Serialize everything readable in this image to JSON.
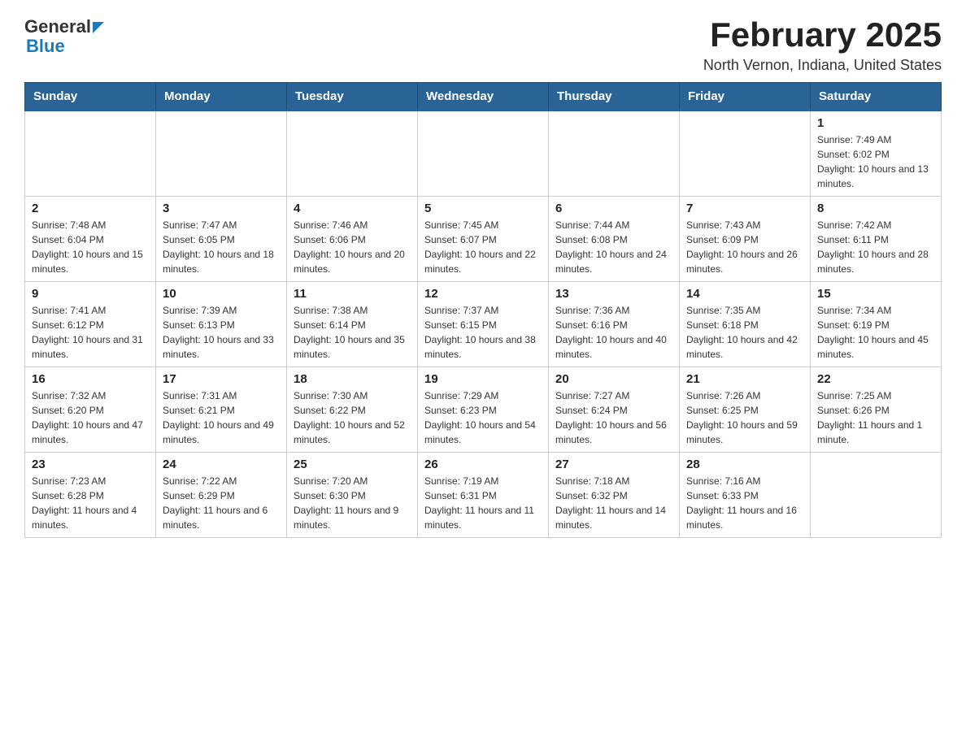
{
  "header": {
    "logo_general": "General",
    "logo_blue": "Blue",
    "title": "February 2025",
    "subtitle": "North Vernon, Indiana, United States"
  },
  "weekdays": [
    "Sunday",
    "Monday",
    "Tuesday",
    "Wednesday",
    "Thursday",
    "Friday",
    "Saturday"
  ],
  "weeks": [
    [
      {
        "day": "",
        "info": ""
      },
      {
        "day": "",
        "info": ""
      },
      {
        "day": "",
        "info": ""
      },
      {
        "day": "",
        "info": ""
      },
      {
        "day": "",
        "info": ""
      },
      {
        "day": "",
        "info": ""
      },
      {
        "day": "1",
        "info": "Sunrise: 7:49 AM\nSunset: 6:02 PM\nDaylight: 10 hours and 13 minutes."
      }
    ],
    [
      {
        "day": "2",
        "info": "Sunrise: 7:48 AM\nSunset: 6:04 PM\nDaylight: 10 hours and 15 minutes."
      },
      {
        "day": "3",
        "info": "Sunrise: 7:47 AM\nSunset: 6:05 PM\nDaylight: 10 hours and 18 minutes."
      },
      {
        "day": "4",
        "info": "Sunrise: 7:46 AM\nSunset: 6:06 PM\nDaylight: 10 hours and 20 minutes."
      },
      {
        "day": "5",
        "info": "Sunrise: 7:45 AM\nSunset: 6:07 PM\nDaylight: 10 hours and 22 minutes."
      },
      {
        "day": "6",
        "info": "Sunrise: 7:44 AM\nSunset: 6:08 PM\nDaylight: 10 hours and 24 minutes."
      },
      {
        "day": "7",
        "info": "Sunrise: 7:43 AM\nSunset: 6:09 PM\nDaylight: 10 hours and 26 minutes."
      },
      {
        "day": "8",
        "info": "Sunrise: 7:42 AM\nSunset: 6:11 PM\nDaylight: 10 hours and 28 minutes."
      }
    ],
    [
      {
        "day": "9",
        "info": "Sunrise: 7:41 AM\nSunset: 6:12 PM\nDaylight: 10 hours and 31 minutes."
      },
      {
        "day": "10",
        "info": "Sunrise: 7:39 AM\nSunset: 6:13 PM\nDaylight: 10 hours and 33 minutes."
      },
      {
        "day": "11",
        "info": "Sunrise: 7:38 AM\nSunset: 6:14 PM\nDaylight: 10 hours and 35 minutes."
      },
      {
        "day": "12",
        "info": "Sunrise: 7:37 AM\nSunset: 6:15 PM\nDaylight: 10 hours and 38 minutes."
      },
      {
        "day": "13",
        "info": "Sunrise: 7:36 AM\nSunset: 6:16 PM\nDaylight: 10 hours and 40 minutes."
      },
      {
        "day": "14",
        "info": "Sunrise: 7:35 AM\nSunset: 6:18 PM\nDaylight: 10 hours and 42 minutes."
      },
      {
        "day": "15",
        "info": "Sunrise: 7:34 AM\nSunset: 6:19 PM\nDaylight: 10 hours and 45 minutes."
      }
    ],
    [
      {
        "day": "16",
        "info": "Sunrise: 7:32 AM\nSunset: 6:20 PM\nDaylight: 10 hours and 47 minutes."
      },
      {
        "day": "17",
        "info": "Sunrise: 7:31 AM\nSunset: 6:21 PM\nDaylight: 10 hours and 49 minutes."
      },
      {
        "day": "18",
        "info": "Sunrise: 7:30 AM\nSunset: 6:22 PM\nDaylight: 10 hours and 52 minutes."
      },
      {
        "day": "19",
        "info": "Sunrise: 7:29 AM\nSunset: 6:23 PM\nDaylight: 10 hours and 54 minutes."
      },
      {
        "day": "20",
        "info": "Sunrise: 7:27 AM\nSunset: 6:24 PM\nDaylight: 10 hours and 56 minutes."
      },
      {
        "day": "21",
        "info": "Sunrise: 7:26 AM\nSunset: 6:25 PM\nDaylight: 10 hours and 59 minutes."
      },
      {
        "day": "22",
        "info": "Sunrise: 7:25 AM\nSunset: 6:26 PM\nDaylight: 11 hours and 1 minute."
      }
    ],
    [
      {
        "day": "23",
        "info": "Sunrise: 7:23 AM\nSunset: 6:28 PM\nDaylight: 11 hours and 4 minutes."
      },
      {
        "day": "24",
        "info": "Sunrise: 7:22 AM\nSunset: 6:29 PM\nDaylight: 11 hours and 6 minutes."
      },
      {
        "day": "25",
        "info": "Sunrise: 7:20 AM\nSunset: 6:30 PM\nDaylight: 11 hours and 9 minutes."
      },
      {
        "day": "26",
        "info": "Sunrise: 7:19 AM\nSunset: 6:31 PM\nDaylight: 11 hours and 11 minutes."
      },
      {
        "day": "27",
        "info": "Sunrise: 7:18 AM\nSunset: 6:32 PM\nDaylight: 11 hours and 14 minutes."
      },
      {
        "day": "28",
        "info": "Sunrise: 7:16 AM\nSunset: 6:33 PM\nDaylight: 11 hours and 16 minutes."
      },
      {
        "day": "",
        "info": ""
      }
    ]
  ]
}
